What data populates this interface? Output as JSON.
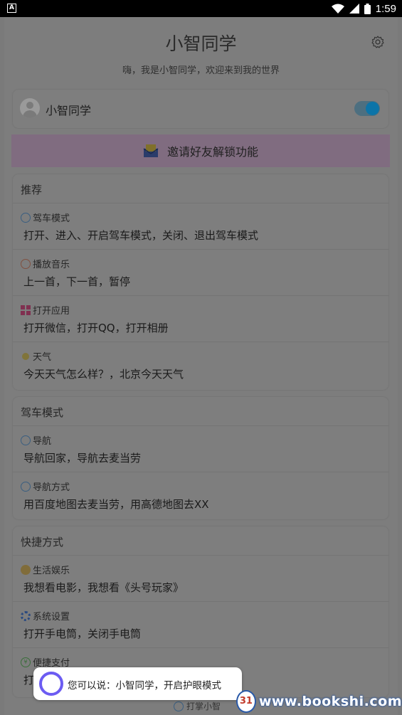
{
  "status_bar": {
    "notif_icon": "A",
    "time": "1:59",
    "icons": [
      "wifi-icon",
      "signal-icon",
      "battery-icon"
    ]
  },
  "header": {
    "title": "小智同学",
    "subtitle": "嗨，我是小智同学，欢迎来到我的世界",
    "settings_icon": "gear-icon"
  },
  "user": {
    "name": "小智同学",
    "toggle_on": true
  },
  "invite": {
    "label": "邀请好友解锁功能",
    "icon": "envelope-icon"
  },
  "sections": [
    {
      "title": "推荐",
      "items": [
        {
          "category": "驾车模式",
          "icon": "steering-icon",
          "example": "打开、进入、开启驾车模式，关闭、退出驾车模式"
        },
        {
          "category": "播放音乐",
          "icon": "music-icon",
          "example": "上一首，下一首，暂停"
        },
        {
          "category": "打开应用",
          "icon": "apps-icon",
          "example": "打开微信，打开QQ，打开相册"
        },
        {
          "category": "天气",
          "icon": "weather-icon",
          "example": "今天天气怎么样？，北京今天天气"
        }
      ]
    },
    {
      "title": "驾车模式",
      "items": [
        {
          "category": "导航",
          "icon": "navigation-icon",
          "example": "导航回家，导航去麦当劳"
        },
        {
          "category": "导航方式",
          "icon": "navigation-icon",
          "example": "用百度地图去麦当劳，用高德地图去XX"
        }
      ]
    },
    {
      "title": "快捷方式",
      "items": [
        {
          "category": "生活娱乐",
          "icon": "emoji-icon",
          "example": "我想看电影，我想看《头号玩家》"
        },
        {
          "category": "系统设置",
          "icon": "settings-icon",
          "example": "打开手电筒，关闭手电筒"
        },
        {
          "category": "便捷支付",
          "icon": "yen-icon",
          "example": "打"
        }
      ]
    }
  ],
  "peek_item": {
    "label": "打掌小智"
  },
  "toast": {
    "text": "您可以说：小智同学，开启护眼模式"
  },
  "watermark": {
    "text": "www.bookshi.com",
    "logo_text": "31"
  }
}
